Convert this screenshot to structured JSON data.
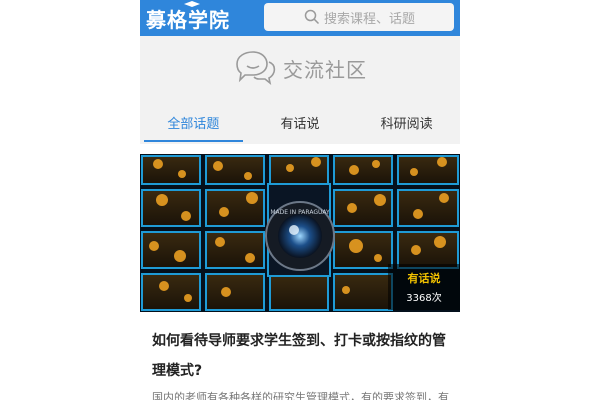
{
  "header": {
    "logo_text": "募格学院",
    "search_placeholder": "搜索课程、话题",
    "brand_color": "#2f86db"
  },
  "community": {
    "icon": "chat-bubbles-icon",
    "title": "交流社区"
  },
  "tabs": [
    {
      "label": "全部话题",
      "active": true
    },
    {
      "label": "有话说",
      "active": false
    },
    {
      "label": "科研阅读",
      "active": false
    }
  ],
  "post": {
    "badge_label": "有话说",
    "badge_count": "3368次",
    "title": "如何看待导师要求学生签到、打卡或按指纹的管理模式?",
    "excerpt": "国内的老师有各种各样的研究生管理模式，有的要求签到，有",
    "image_text": "MADE IN PARAGUAY"
  }
}
